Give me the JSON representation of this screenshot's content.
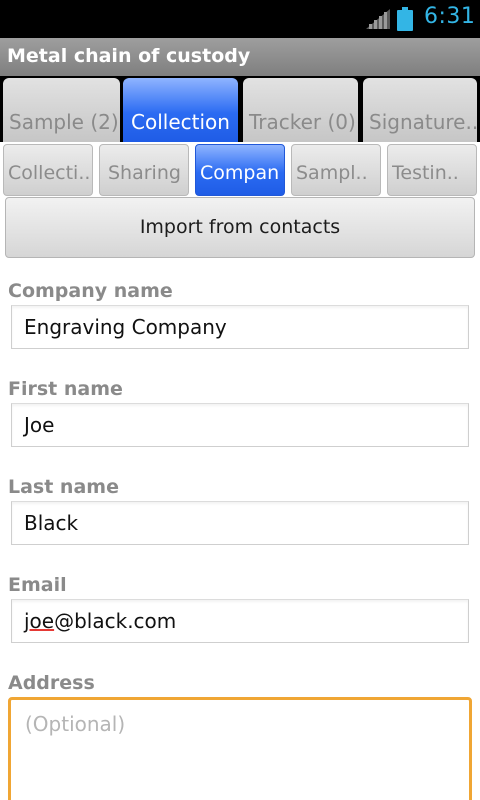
{
  "status_bar": {
    "time": "6:31",
    "accent_color": "#33b5e5",
    "icons": [
      "signal-icon",
      "battery-icon"
    ]
  },
  "app": {
    "title": "Metal chain of custody"
  },
  "main_tabs": [
    {
      "label": "Sample (2)",
      "active": false
    },
    {
      "label": "Collection",
      "active": true
    },
    {
      "label": "Tracker (0)",
      "active": false
    },
    {
      "label": "Signature..",
      "active": false
    }
  ],
  "sub_tabs": [
    {
      "label": "Collecti..",
      "active": false
    },
    {
      "label": "Sharing",
      "active": false
    },
    {
      "label": "Compan",
      "active": true
    },
    {
      "label": "Sampl..",
      "active": false
    },
    {
      "label": "Testin..",
      "active": false
    }
  ],
  "import_button": {
    "label": "Import from contacts"
  },
  "form": {
    "company_name": {
      "label": "Company name",
      "value": "Engraving Company"
    },
    "first_name": {
      "label": "First name",
      "value": "Joe"
    },
    "last_name": {
      "label": "Last name",
      "value": "Black"
    },
    "email": {
      "label": "Email",
      "value_misspelled_part": "joe",
      "value_rest": "@black.com"
    },
    "address": {
      "label": "Address",
      "placeholder": "(Optional)",
      "focus_color": "#f0a634"
    }
  },
  "colors": {
    "active_tab": "#2b6bf2",
    "title_bar": "#8c8c8c",
    "label": "#8a8a8a"
  }
}
